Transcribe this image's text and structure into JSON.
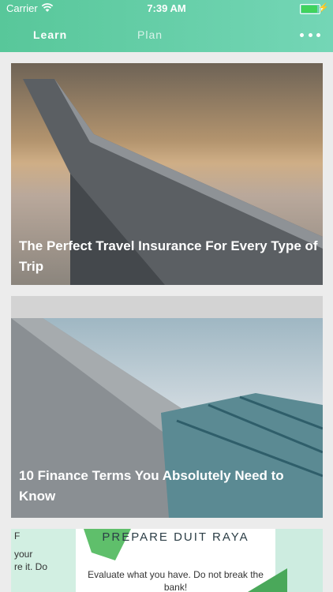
{
  "status_bar": {
    "carrier": "Carrier",
    "time": "7:39 AM"
  },
  "tabs": [
    {
      "label": "Learn",
      "active": true
    },
    {
      "label": "Plan",
      "active": false
    }
  ],
  "cards": [
    {
      "title": "The Perfect Travel Insurance For Every Type of Trip",
      "image": "airplane-wing"
    },
    {
      "title": "10 Finance Terms You Absolutely Need to Know",
      "image": "glass-building"
    }
  ],
  "poster": {
    "title": "PREPARE DUIT RAYA",
    "body": "Evaluate what you have. Do not break the bank!",
    "side_letter": "F",
    "side_text": "your\nre it. Do"
  },
  "colors": {
    "header_start": "#58c79a",
    "header_end": "#74d6b6",
    "battery": "#41d35c"
  }
}
